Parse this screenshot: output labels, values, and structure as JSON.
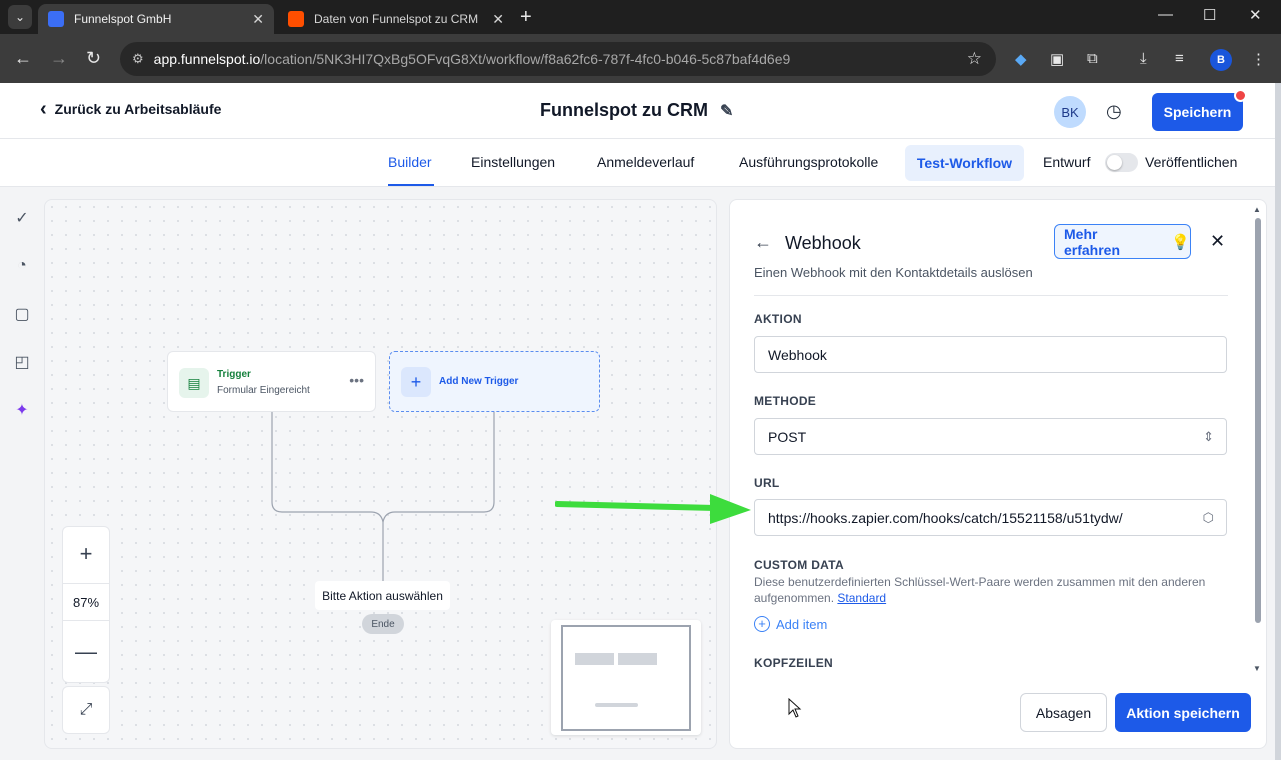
{
  "browser": {
    "tabs": [
      {
        "label": "Funnelspot GmbH",
        "favicon_color": "#3b6ef5"
      },
      {
        "label": "Daten von Funnelspot zu CRM",
        "favicon_color": "#ff4f00"
      }
    ],
    "address": {
      "domain": "app.funnelspot.io",
      "path": "/location/5NK3HI7QxBg5OFvqG8Xt/workflow/f8a62fc6-787f-4fc0-b046-5c87baf4d6e9"
    },
    "profile_initial": "B"
  },
  "header": {
    "back_label": "Zurück zu Arbeitsabläufe",
    "title": "Funnelspot zu CRM",
    "avatar_initials": "BK",
    "save_label": "Speichern"
  },
  "nav": {
    "tabs": [
      "Builder",
      "Einstellungen",
      "Anmeldeverlauf",
      "Ausführungsprotokolle"
    ],
    "active_tab": "Builder",
    "test_label": "Test-Workflow",
    "draft_label": "Entwurf",
    "publish_label": "Veröffentlichen",
    "published": false
  },
  "canvas": {
    "trigger": {
      "title": "Trigger",
      "subtitle": "Formular Eingereicht"
    },
    "add_trigger_label": "Add New Trigger",
    "action_placeholder": "Bitte Aktion auswählen",
    "end_label": "Ende",
    "zoom": "87%"
  },
  "panel": {
    "title": "Webhook",
    "learn_more": "Mehr erfahren",
    "description": "Einen Webhook mit den Kontaktdetails auslösen",
    "action_label": "AKTION",
    "action_value": "Webhook",
    "method_label": "METHODE",
    "method_value": "POST",
    "url_label": "URL",
    "url_value": "https://hooks.zapier.com/hooks/catch/15521158/u51tydw/",
    "custom_data_label": "CUSTOM DATA",
    "custom_data_desc": "Diese benutzerdefinierten Schlüssel-Wert-Paare werden zusammen mit den anderen aufgenommen.",
    "custom_data_link": "Standard",
    "add_item": "Add item",
    "headers_label": "KOPFZEILEN",
    "cancel": "Absagen",
    "save": "Aktion speichern"
  },
  "colors": {
    "primary": "#1d5ae8",
    "trigger_green": "#15803d",
    "annotation_arrow": "#3ddc3d"
  }
}
